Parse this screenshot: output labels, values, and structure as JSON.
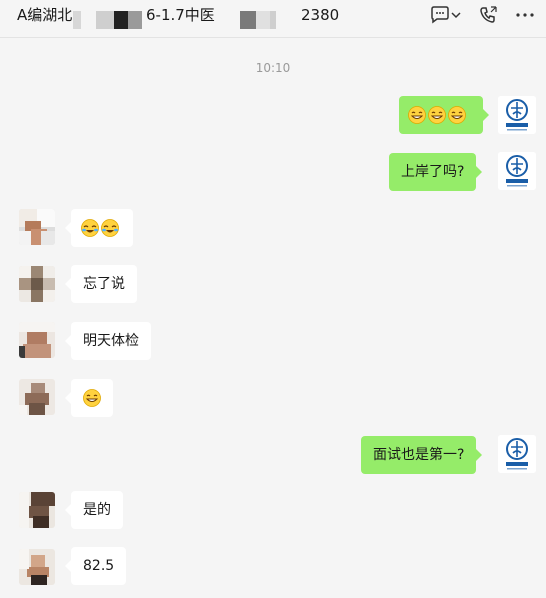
{
  "header": {
    "title_parts": [
      "A编湖北",
      "6-1.7中医",
      "2380"
    ],
    "icons": [
      "chat-bubble-icon",
      "chevron-down-icon",
      "phone-icon",
      "more-icon"
    ]
  },
  "chat": {
    "timestamp": "10:10",
    "messages": [
      {
        "side": "right",
        "type": "emoji",
        "emoji": "grin",
        "count": 3
      },
      {
        "side": "right",
        "type": "text",
        "text": "上岸了吗?"
      },
      {
        "side": "left",
        "type": "emoji",
        "emoji": "laugh-cry",
        "count": 2
      },
      {
        "side": "left",
        "type": "text",
        "text": "忘了说"
      },
      {
        "side": "left",
        "type": "text",
        "text": "明天体检"
      },
      {
        "side": "left",
        "type": "emoji",
        "emoji": "grin",
        "count": 1
      },
      {
        "side": "right",
        "type": "text",
        "text": "面试也是第一?"
      },
      {
        "side": "left",
        "type": "text",
        "text": "是的"
      },
      {
        "side": "left",
        "type": "text",
        "text": "82.5"
      }
    ],
    "self_avatar_logo_text": "中公教育"
  },
  "colors": {
    "self_bubble": "#95ec69",
    "other_bubble": "#ffffff",
    "background": "#f5f5f5"
  }
}
